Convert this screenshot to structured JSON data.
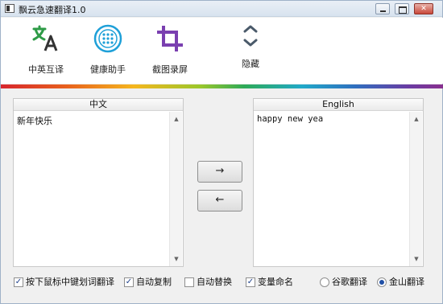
{
  "window": {
    "title": "飘云急速翻译1.0"
  },
  "toolbar": {
    "items": [
      {
        "label": "中英互译",
        "icon": "translate-icon",
        "color": "#2e9b47"
      },
      {
        "label": "健康助手",
        "icon": "health-icon",
        "color": "#1fa0d8"
      },
      {
        "label": "截图录屏",
        "icon": "crop-icon",
        "color": "#7a3fb0"
      },
      {
        "label": "隐藏",
        "icon": "chevron-up-down-icon",
        "color": "#4a5a6a"
      }
    ]
  },
  "source_panel": {
    "header": "中文",
    "text": "新年快乐"
  },
  "target_panel": {
    "header": "English",
    "text": "happy new yea"
  },
  "buttons": {
    "to_target": "→",
    "to_source": "←"
  },
  "options": {
    "checkboxes": [
      {
        "label": "按下鼠标中键划词翻译",
        "checked": true
      },
      {
        "label": "自动复制",
        "checked": true
      },
      {
        "label": "自动替换",
        "checked": false
      },
      {
        "label": "变量命名",
        "checked": true
      }
    ],
    "engines": [
      {
        "label": "谷歌翻译",
        "selected": false
      },
      {
        "label": "金山翻译",
        "selected": true
      }
    ]
  }
}
